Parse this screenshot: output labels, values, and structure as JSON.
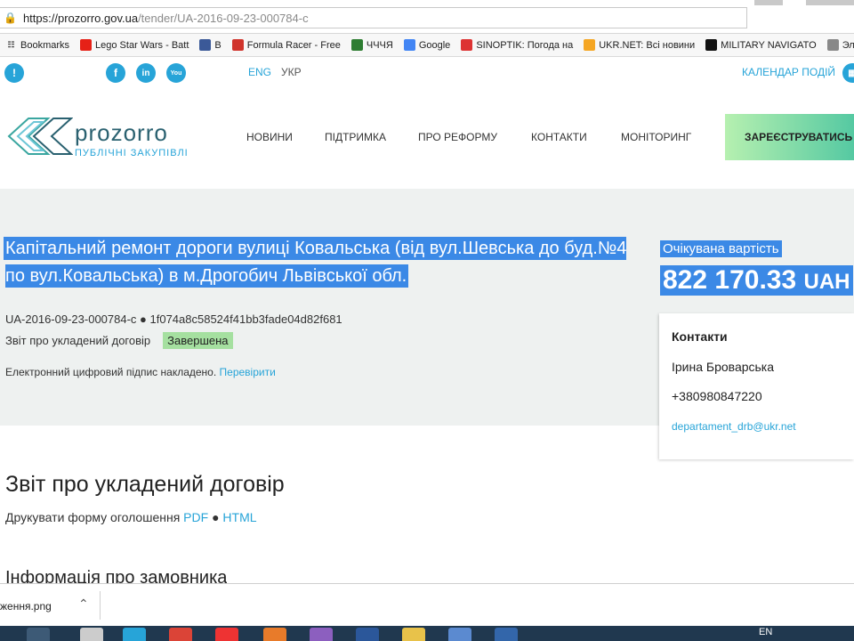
{
  "browser": {
    "url_host": "https://prozorro.gov.ua",
    "url_path": "/tender/UA-2016-09-23-000784-c",
    "bookmarks": [
      {
        "label": "Bookmarks",
        "icon": "apps-icon"
      },
      {
        "label": "Lego Star Wars - Batt",
        "icon": "youtube-icon",
        "color": "#e62117"
      },
      {
        "label": "B",
        "icon": "facebook-icon",
        "color": "#3b5998"
      },
      {
        "label": "Formula Racer - Free",
        "icon": "racer-icon",
        "color": "#d0342c"
      },
      {
        "label": "ЧЧЧЯ",
        "icon": "bookmark-icon",
        "color": "#2e7d32"
      },
      {
        "label": "Google",
        "icon": "google-icon",
        "color": "#4285f4"
      },
      {
        "label": "SINOPTIK: Погода на",
        "icon": "thermometer-icon",
        "color": "#d33"
      },
      {
        "label": "UKR.NET: Всі новини",
        "icon": "ukrnet-icon",
        "color": "#f5a623"
      },
      {
        "label": "MILITARY NAVIGATO",
        "icon": "military-icon",
        "color": "#111"
      },
      {
        "label": "Электрические",
        "icon": "bulb-icon",
        "color": "#888"
      }
    ]
  },
  "site": {
    "lang_eng": "ENG",
    "lang_ukr": "УКР",
    "calendar": "КАЛЕНДАР ПОДІЙ",
    "logo_name": "prozorro",
    "logo_sub": "ПУБЛІЧНІ ЗАКУПІВЛІ",
    "nav": [
      "НОВИНИ",
      "ПІДТРИМКА",
      "ПРО РЕФОРМУ",
      "КОНТАКТИ",
      "МОНІТОРИНГ"
    ],
    "register": "ЗАРЕЄСТРУВАТИСЬ"
  },
  "tender": {
    "title": "Капітальний ремонт дороги вулиці Ковальська (від вул.Шевська до буд.№4 по вул.Ковальська) в м.Дрогобич Львівської обл.",
    "id_line": "UA-2016-09-23-000784-c ● 1f074a8c58524f41bb3fade04d82f681",
    "status_text": "Звіт про укладений договір",
    "status_badge": "Завершена",
    "signature_text": "Електронний цифровий підпис накладено.",
    "signature_link": "Перевірити",
    "expected_label": "Очікувана вартість",
    "expected_value": "822 170.33",
    "expected_currency": "UAH"
  },
  "contacts": {
    "heading": "Контакти",
    "name": "Ірина Броварська",
    "phone": "+380980847220",
    "email": "departament_drb@ukr.net"
  },
  "report": {
    "heading": "Звіт про укладений договір",
    "print_label": "Друкувати форму оголошення",
    "pdf": "PDF",
    "bullet": "●",
    "html": "HTML",
    "customer_heading": "Інформація про замовника"
  },
  "downloads": {
    "file": "ження.png"
  },
  "taskbar": {
    "lang": "EN"
  }
}
